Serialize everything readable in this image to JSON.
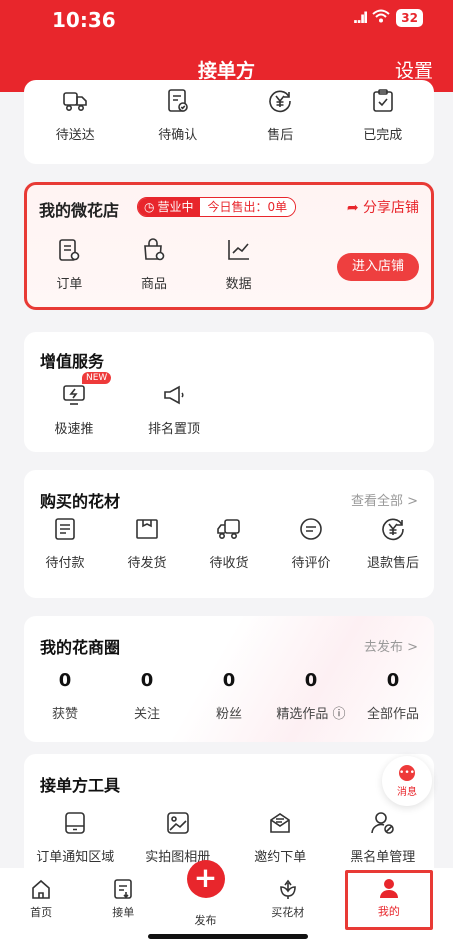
{
  "status_bar": {
    "time": "10:36",
    "signal": "..ıl",
    "wifi": "wifi-icon",
    "battery": "32"
  },
  "header": {
    "title": "接单方",
    "settings": "设置"
  },
  "orders": {
    "items": [
      {
        "icon": "truck-icon",
        "label": "待送达"
      },
      {
        "icon": "document-check-icon",
        "label": "待确认"
      },
      {
        "icon": "yuan-refund-icon",
        "label": "售后"
      },
      {
        "icon": "clipboard-check-icon",
        "label": "已完成"
      }
    ]
  },
  "shop": {
    "title": "我的微花店",
    "status": "营业中",
    "sold_today": "今日售出：0单",
    "share": "分享店铺",
    "enter": "进入店铺",
    "items": [
      {
        "icon": "order-icon",
        "label": "订单"
      },
      {
        "icon": "bag-icon",
        "label": "商品"
      },
      {
        "icon": "chart-icon",
        "label": "数据"
      }
    ]
  },
  "value_service": {
    "title": "增值服务",
    "new_badge": "NEW",
    "items": [
      {
        "icon": "boost-icon",
        "label": "极速推"
      },
      {
        "icon": "megaphone-icon",
        "label": "排名置顶"
      }
    ]
  },
  "purchased": {
    "title": "购买的花材",
    "link": "查看全部 >",
    "items": [
      {
        "icon": "invoice-icon",
        "label": "待付款"
      },
      {
        "icon": "box-icon",
        "label": "待发货"
      },
      {
        "icon": "truck-icon",
        "label": "待收货"
      },
      {
        "icon": "comment-icon",
        "label": "待评价"
      },
      {
        "icon": "yuan-refund-icon",
        "label": "退款售后"
      }
    ]
  },
  "circle": {
    "title": "我的花商圈",
    "link": "去发布 >",
    "stats": [
      {
        "value": "0",
        "label": "获赞"
      },
      {
        "value": "0",
        "label": "关注"
      },
      {
        "value": "0",
        "label": "粉丝"
      },
      {
        "value": "0",
        "label": "精选作品 ⓘ"
      },
      {
        "value": "0",
        "label": "全部作品"
      }
    ]
  },
  "tools": {
    "title": "接单方工具",
    "items": [
      {
        "icon": "tablet-icon",
        "label": "订单通知区域"
      },
      {
        "icon": "image-icon",
        "label": "实拍图相册"
      },
      {
        "icon": "envelope-icon",
        "label": "邀约下单"
      },
      {
        "icon": "user-block-icon",
        "label": "黑名单管理"
      }
    ]
  },
  "message": {
    "label": "消息",
    "dot": "•••"
  },
  "tabbar": {
    "items": [
      {
        "icon": "home-icon",
        "label": "首页"
      },
      {
        "icon": "receive-order-icon",
        "label": "接单"
      },
      {
        "icon": "plus-icon",
        "label": "发布"
      },
      {
        "icon": "flower-icon",
        "label": "买花材"
      },
      {
        "icon": "user-icon",
        "label": "我的"
      }
    ]
  },
  "colors": {
    "brand": "#e8262c",
    "highlight_border": "#e83a35"
  }
}
